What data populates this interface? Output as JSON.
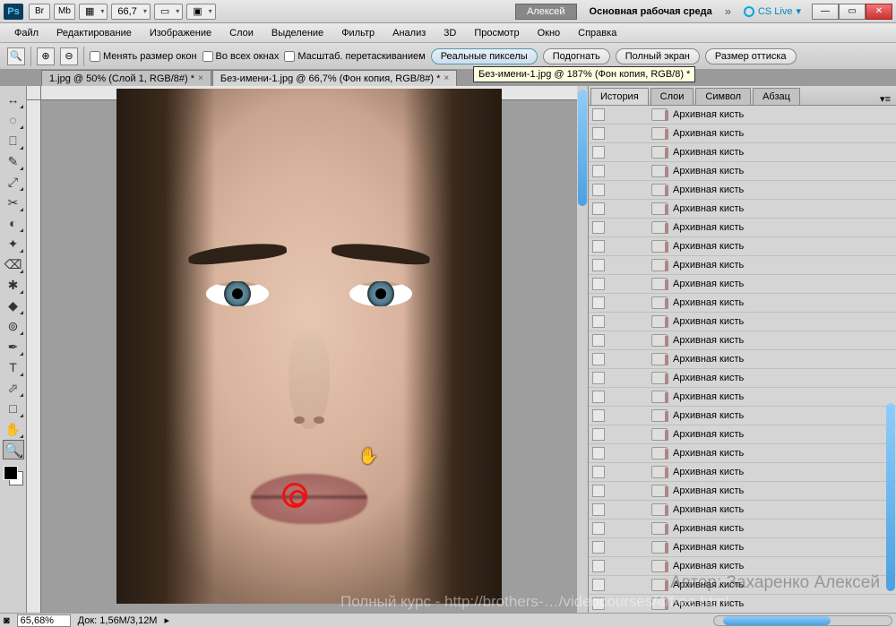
{
  "titlebar": {
    "app": "Ps",
    "btns": {
      "br": "Br",
      "mb": "Mb"
    },
    "zoom": "66,7",
    "user": "Алексей",
    "workspace": "Основная рабочая среда",
    "cslive": "CS Live"
  },
  "menu": [
    "Файл",
    "Редактирование",
    "Изображение",
    "Слои",
    "Выделение",
    "Фильтр",
    "Анализ",
    "3D",
    "Просмотр",
    "Окно",
    "Справка"
  ],
  "options": {
    "chk1": "Менять размер окон",
    "chk2": "Во всех окнах",
    "chk3": "Масштаб. перетаскиванием",
    "b1": "Реальные пикселы",
    "b2": "Подогнать",
    "b3": "Полный экран",
    "b4": "Размер оттиска",
    "tooltip": "Без-имени-1.jpg @ 187% (Фон копия, RGB/8) *"
  },
  "tabs": [
    {
      "label": "1.jpg @ 50% (Слой 1, RGB/8#) *"
    },
    {
      "label": "Без-имени-1.jpg @ 66,7% (Фон копия, RGB/8#) *"
    }
  ],
  "panel": {
    "tabs": [
      "История",
      "Слои",
      "Символ",
      "Абзац"
    ],
    "history_item": "Архивная кисть",
    "history_count": 28
  },
  "status": {
    "zoom": "65,68%",
    "doc": "Док: 1,56M/3,12M"
  },
  "watermark1": "Полный курс - http://brothers-…/videocourses/4/free.html",
  "watermark2": "Автор: Захаренко Алексей",
  "tool_glyphs": [
    "↔",
    "◌",
    "⎕",
    "✎",
    "⤢",
    "✂",
    "◐",
    "✦",
    "⌫",
    "✱",
    "◆",
    "⊚",
    "✒",
    "T",
    "⬀",
    "□",
    "✋",
    "🔍"
  ]
}
